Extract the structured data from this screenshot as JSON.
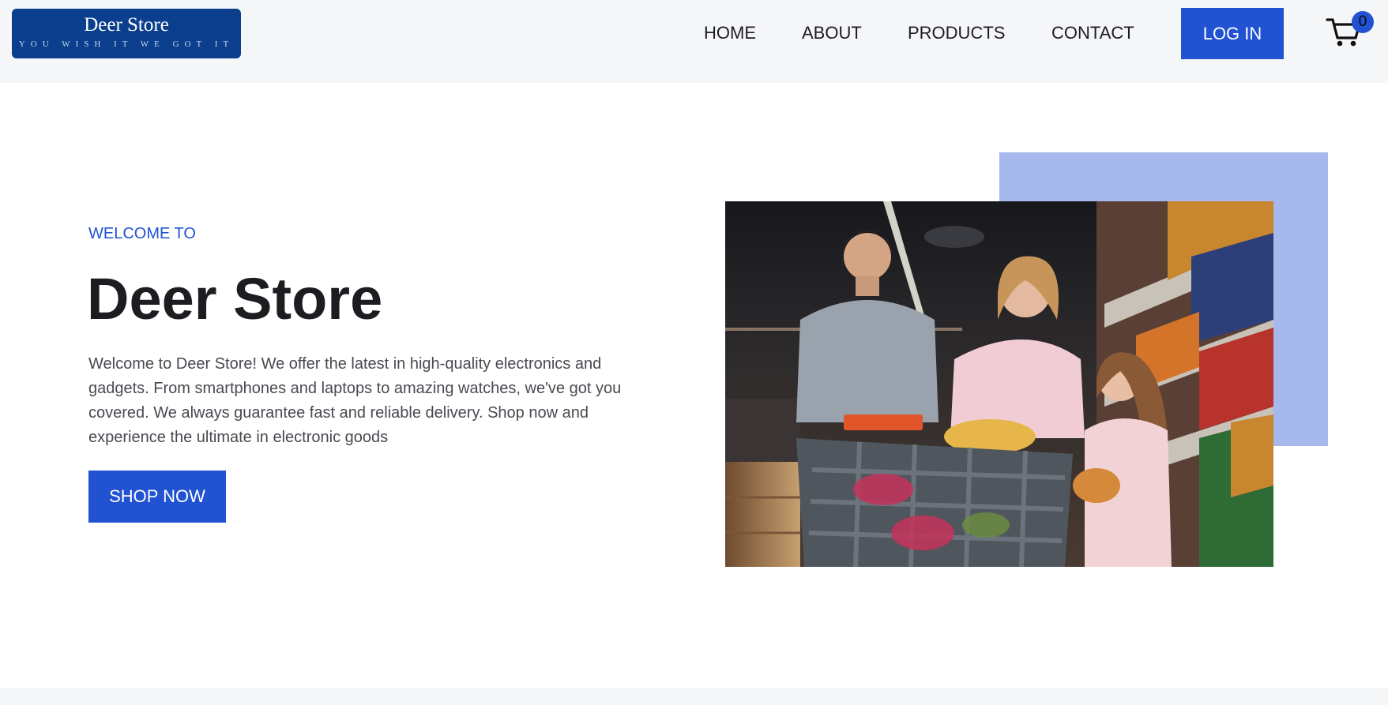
{
  "brand": {
    "name": "Deer Store",
    "tagline": "YOU WISH IT WE GOT IT"
  },
  "nav": {
    "items": [
      {
        "label": "HOME"
      },
      {
        "label": "ABOUT"
      },
      {
        "label": "PRODUCTS"
      },
      {
        "label": "CONTACT"
      }
    ],
    "login_label": "LOG IN",
    "cart_count": "0"
  },
  "hero": {
    "eyebrow": "WELCOME TO",
    "title": "Deer Store",
    "description": "Welcome to Deer Store! We offer the latest in high-quality electronics and gadgets. From smartphones and laptops to amazing watches, we've got you covered. We always guarantee fast and reliable delivery. Shop now and experience the ultimate in electronic goods",
    "cta_label": "SHOP NOW",
    "image": "family-grocery-shopping-photo"
  },
  "colors": {
    "accent": "#2152d2",
    "accent_light": "#a6b8ec",
    "logo_bg": "#0b3f8e",
    "header_bg": "#f5f6f8",
    "text_dark": "#1c1d20",
    "text_body": "#474a50"
  },
  "icons": {
    "cart": "shopping-cart-icon"
  }
}
